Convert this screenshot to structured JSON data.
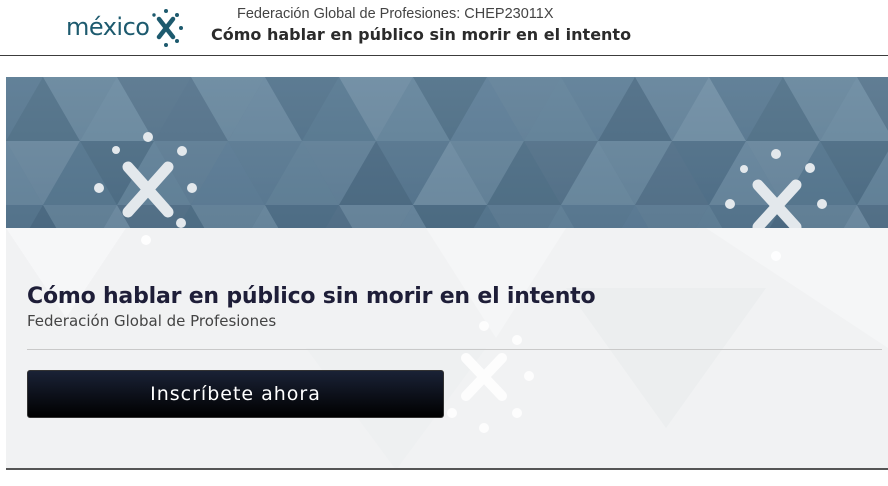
{
  "header": {
    "logo_text": "méxico",
    "logo_icon": "mexicox-logo-x-icon",
    "organization": "Federación Global de Profesiones: CHEP23011X",
    "course_title": "Cómo hablar en público sin morir en el intento"
  },
  "banner": {
    "image": "triangle-pattern-banner"
  },
  "main": {
    "course_title": "Cómo hablar en público sin morir en el intento",
    "organization": "Federación Global de Profesiones",
    "enroll_button": "Inscríbete ahora"
  },
  "colors": {
    "logo_teal": "#1d5a6e",
    "banner_blue": "#5d7c92",
    "button_dark": "#000000",
    "panel_bg": "#f1f2f3"
  }
}
